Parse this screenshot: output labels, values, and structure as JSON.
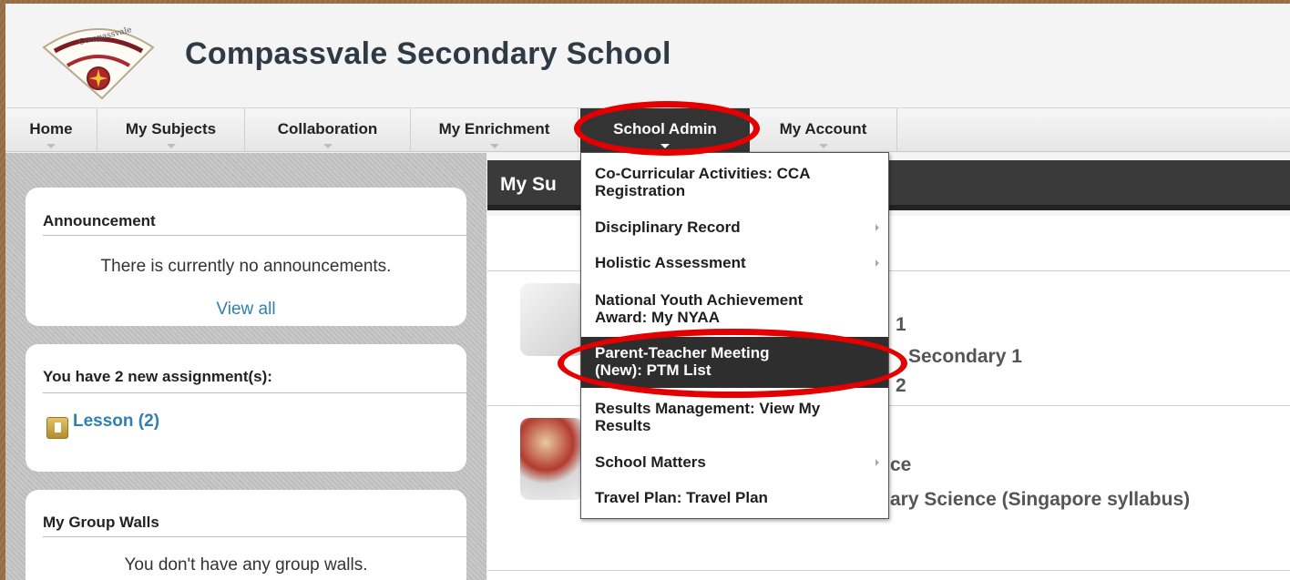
{
  "header": {
    "school_name": "Compassvale Secondary School"
  },
  "nav": [
    {
      "label": "Home"
    },
    {
      "label": "My Subjects"
    },
    {
      "label": "Collaboration"
    },
    {
      "label": "My Enrichment"
    },
    {
      "label": "School Admin"
    },
    {
      "label": "My Account"
    }
  ],
  "sidebar": {
    "announcement": {
      "title": "Announcement",
      "text": "There is currently no announcements.",
      "link": "View all"
    },
    "assignments": {
      "title": "You have 2 new assignment(s):",
      "lesson_link": "Lesson (2)"
    },
    "group_walls": {
      "title": "My Group Walls",
      "text": "You don't have any group walls."
    }
  },
  "main": {
    "header_title": "My Su",
    "subject1": {
      "line1": "1",
      "line2": "Secondary 1",
      "line3": "2"
    },
    "subject2": {
      "line1": "ce",
      "line2": "ary Science (Singapore syllabus)"
    }
  },
  "dropdown": {
    "items": [
      {
        "label_line1": "Co-Curricular Activities: CCA",
        "label_line2": "Registration",
        "has_submenu": false
      },
      {
        "label_line1": "Disciplinary Record",
        "has_submenu": true
      },
      {
        "label_line1": "Holistic Assessment",
        "has_submenu": true
      },
      {
        "label_line1": "National Youth Achievement",
        "label_line2": "Award: My NYAA",
        "has_submenu": false
      },
      {
        "label_line1": "Parent-Teacher Meeting",
        "label_line2": "(New): PTM List",
        "has_submenu": false,
        "highlighted": true
      },
      {
        "label_line1": "Results Management: View My",
        "label_line2": "Results",
        "has_submenu": false
      },
      {
        "label_line1": "School Matters",
        "has_submenu": true
      },
      {
        "label_line1": "Travel Plan: Travel Plan",
        "has_submenu": false
      }
    ]
  },
  "colors": {
    "annotation_red": "#e40000",
    "nav_active": "#333333",
    "link_blue": "#2f7fb3"
  }
}
